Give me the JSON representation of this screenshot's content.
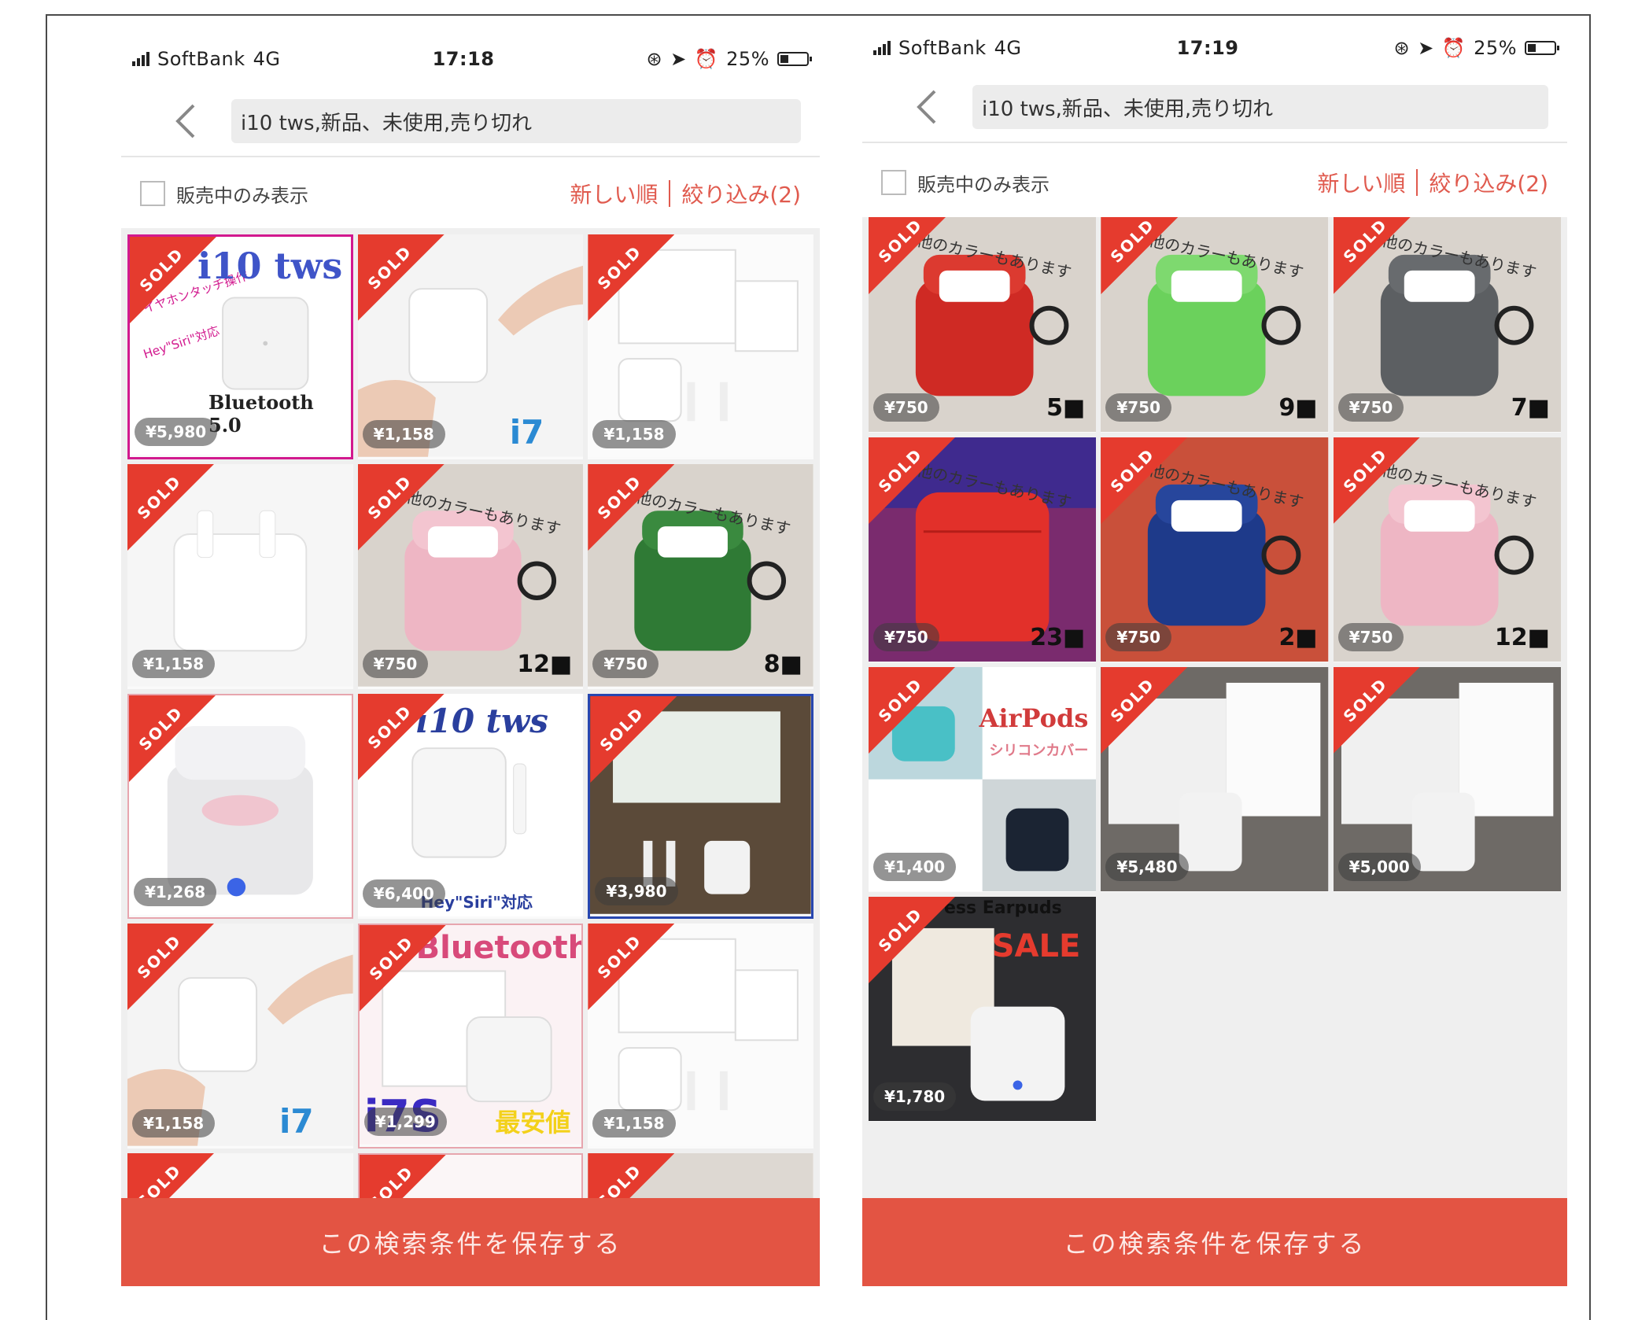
{
  "colors": {
    "accent": "#e05a4e",
    "sold_ribbon": "#e53b2e",
    "save_button": "#e35443"
  },
  "screens": [
    {
      "status": {
        "carrier": "SoftBank",
        "network": "4G",
        "time": "17:18",
        "battery": "25%"
      },
      "search": {
        "query": "i10 tws,新品、未使用,売り切れ"
      },
      "filter": {
        "checkbox_label": "販売中のみ表示",
        "sort_label": "新しい順",
        "refine_label": "絞り込み(2)"
      },
      "items": [
        {
          "sold": "SOLD",
          "price": "¥5,980",
          "title": "i10 tws",
          "subtitle": "Bluetooth 5.0"
        },
        {
          "sold": "SOLD",
          "price": "¥1,158",
          "title": "i7"
        },
        {
          "sold": "SOLD",
          "price": "¥1,158"
        },
        {
          "sold": "SOLD",
          "price": "¥1,158"
        },
        {
          "sold": "SOLD",
          "price": "¥750",
          "count": "12■",
          "banner": "他のカラーもあります"
        },
        {
          "sold": "SOLD",
          "price": "¥750",
          "count": "8■",
          "banner": "他のカラーもあります"
        },
        {
          "sold": "SOLD",
          "price": "¥1,268"
        },
        {
          "sold": "SOLD",
          "price": "¥6,400",
          "title": "i10 tws",
          "subtitle": "Hey\"Siri\"対応"
        },
        {
          "sold": "SOLD",
          "price": "¥3,980"
        },
        {
          "sold": "SOLD",
          "price": "¥1,158",
          "title": "i7"
        },
        {
          "sold": "SOLD",
          "price": "¥1,299",
          "title": "Bluetooth",
          "subtitle": "i7S",
          "extra": "最安値"
        },
        {
          "sold": "SOLD",
          "price": "¥1,158"
        },
        {
          "sold": "SOLD"
        },
        {
          "sold": "SOLD"
        },
        {
          "sold": "SOLD"
        }
      ],
      "save_button": "この検索条件を保存する"
    },
    {
      "status": {
        "carrier": "SoftBank",
        "network": "4G",
        "time": "17:19",
        "battery": "25%"
      },
      "search": {
        "query": "i10 tws,新品、未使用,売り切れ"
      },
      "filter": {
        "checkbox_label": "販売中のみ表示",
        "sort_label": "新しい順",
        "refine_label": "絞り込み(2)"
      },
      "items": [
        {
          "sold": "SOLD",
          "price": "¥750",
          "count": "5■",
          "banner": "他のカラーもあります"
        },
        {
          "sold": "SOLD",
          "price": "¥750",
          "count": "9■",
          "banner": "他のカラーもあります"
        },
        {
          "sold": "SOLD",
          "price": "¥750",
          "count": "7■",
          "banner": "他のカラーもあります"
        },
        {
          "sold": "SOLD",
          "price": "¥750",
          "count": "23■",
          "banner": "他のカラーもあります"
        },
        {
          "sold": "SOLD",
          "price": "¥750",
          "count": "2■",
          "banner": "他のカラーもあります"
        },
        {
          "sold": "SOLD",
          "price": "¥750",
          "count": "12■",
          "banner": "他のカラーもあります"
        },
        {
          "sold": "SOLD",
          "price": "¥1,400",
          "title": "AirPods",
          "subtitle": "シリコンカバー"
        },
        {
          "sold": "SOLD",
          "price": "¥5,480"
        },
        {
          "sold": "SOLD",
          "price": "¥5,000"
        },
        {
          "sold": "SOLD",
          "price": "¥1,780",
          "title": "ess Earpuds",
          "subtitle": "SALE"
        }
      ],
      "save_button": "この検索条件を保存する"
    }
  ]
}
